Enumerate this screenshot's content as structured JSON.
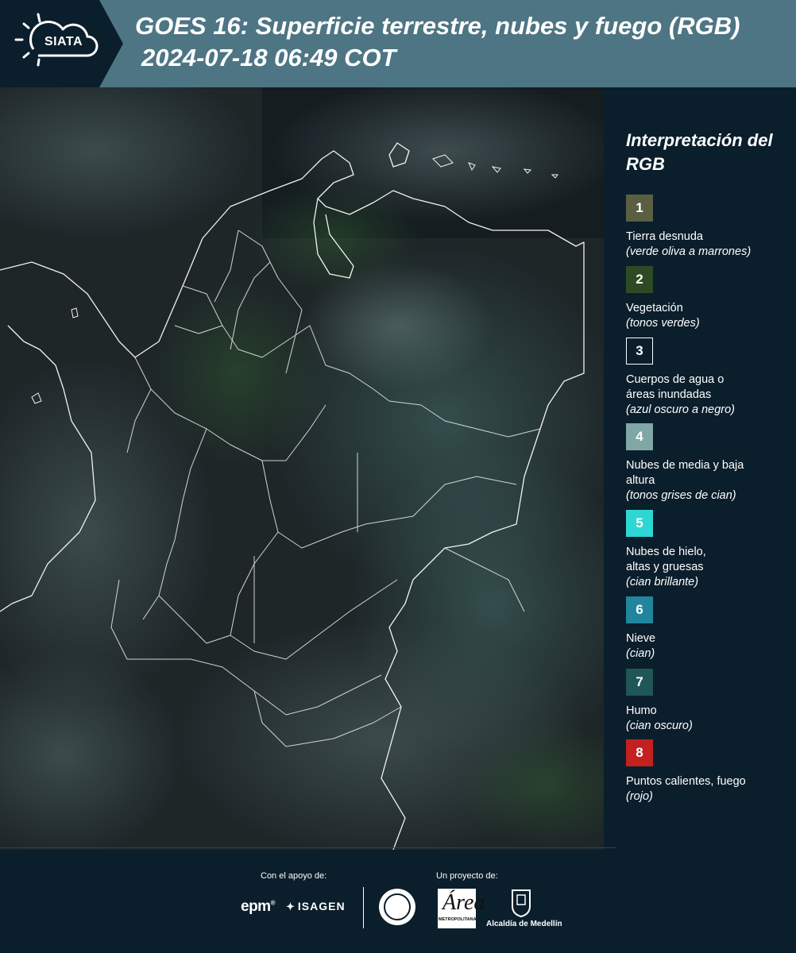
{
  "header": {
    "logo_text": "SIATA",
    "title": "GOES 16: Superficie terrestre, nubes y fuego (RGB)",
    "subtitle": "2024-07-18 06:49 COT"
  },
  "legend": {
    "title": "Interpretación del RGB",
    "items": [
      {
        "number": "1",
        "label": "Tierra desnuda",
        "note": "(verde oliva a marrones)",
        "color": "#5a5e43"
      },
      {
        "number": "2",
        "label": "Vegetación",
        "note": "(tonos verdes)",
        "color": "#2e4a24"
      },
      {
        "number": "3",
        "label": "Cuerpos de agua o áreas inundadas",
        "note": "(azul oscuro a negro)",
        "color": "#0b1e2b"
      },
      {
        "number": "4",
        "label": "Nubes de media y baja altura",
        "note": "(tonos grises de cian)",
        "color": "#7ea7a5"
      },
      {
        "number": "5",
        "label": "Nubes de hielo, altas y gruesas",
        "note": "(cian brillante)",
        "color": "#2ed6d4"
      },
      {
        "number": "6",
        "label": "Nieve",
        "note": "(cian)",
        "color": "#21869d"
      },
      {
        "number": "7",
        "label": "Humo",
        "note": "(cian oscuro)",
        "color": "#1f5658"
      },
      {
        "number": "8",
        "label": "Puntos calientes, fuego",
        "note": "(rojo)",
        "color": "#c3201f"
      }
    ]
  },
  "footer": {
    "support_label": "Con el apoyo de:",
    "project_label": "Un proyecto de:",
    "sponsor_1": "epm",
    "sponsor_2": "ISAGEN",
    "partner_area_mark": "Área",
    "partner_area_text": "METROPOLITANA",
    "partner_city": "Alcaldía de Medellín"
  }
}
